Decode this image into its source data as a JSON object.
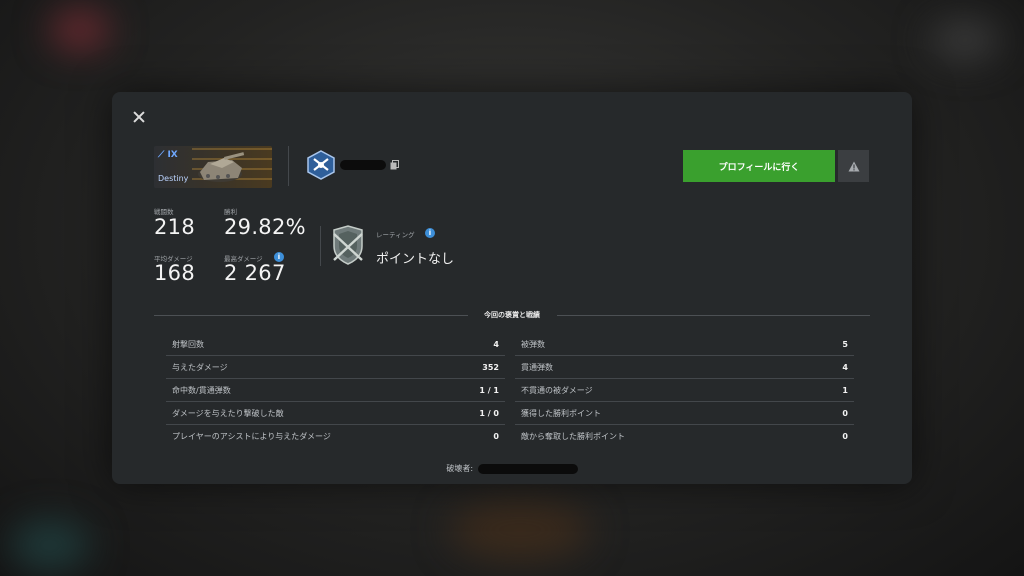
{
  "header": {
    "tank": {
      "tier": "IX",
      "name": "Destiny"
    },
    "profile_button": "プロフィールに行く"
  },
  "stats": {
    "battles": {
      "label": "戦闘数",
      "value": "218"
    },
    "winrate": {
      "label": "勝利",
      "value": "29.82%"
    },
    "avg_damage": {
      "label": "平均ダメージ",
      "value": "168"
    },
    "max_damage": {
      "label": "最高ダメージ",
      "value": "2 267"
    }
  },
  "rating": {
    "label": "レーティング",
    "value": "ポイントなし"
  },
  "section_title": "今回の褒賞と戦績",
  "left_table": [
    {
      "label": "射撃回数",
      "value": "4"
    },
    {
      "label": "与えたダメージ",
      "value": "352"
    },
    {
      "label": "命中数/貫通弾数",
      "value": "1 / 1"
    },
    {
      "label": "ダメージを与えたり撃破した敵",
      "value": "1 / 0"
    },
    {
      "label": "プレイヤーのアシストにより与えたダメージ",
      "value": "0"
    }
  ],
  "right_table": [
    {
      "label": "被弾数",
      "value": "5"
    },
    {
      "label": "貫通弾数",
      "value": "4"
    },
    {
      "label": "不貫通の被ダメージ",
      "value": "1"
    },
    {
      "label": "獲得した勝利ポイント",
      "value": "0"
    },
    {
      "label": "敵から奪取した勝利ポイント",
      "value": "0"
    }
  ],
  "destroyer_label": "破壊者:",
  "icons": {
    "close": "close-icon",
    "copy": "copy-icon",
    "report": "warning-icon",
    "info": "info-icon",
    "clan": "clan-emblem-icon",
    "rating": "rating-shield-icon"
  },
  "colors": {
    "accent_green": "#3aa02e",
    "info_blue": "#3d8fd9",
    "tier_blue": "#6fa8ff"
  }
}
